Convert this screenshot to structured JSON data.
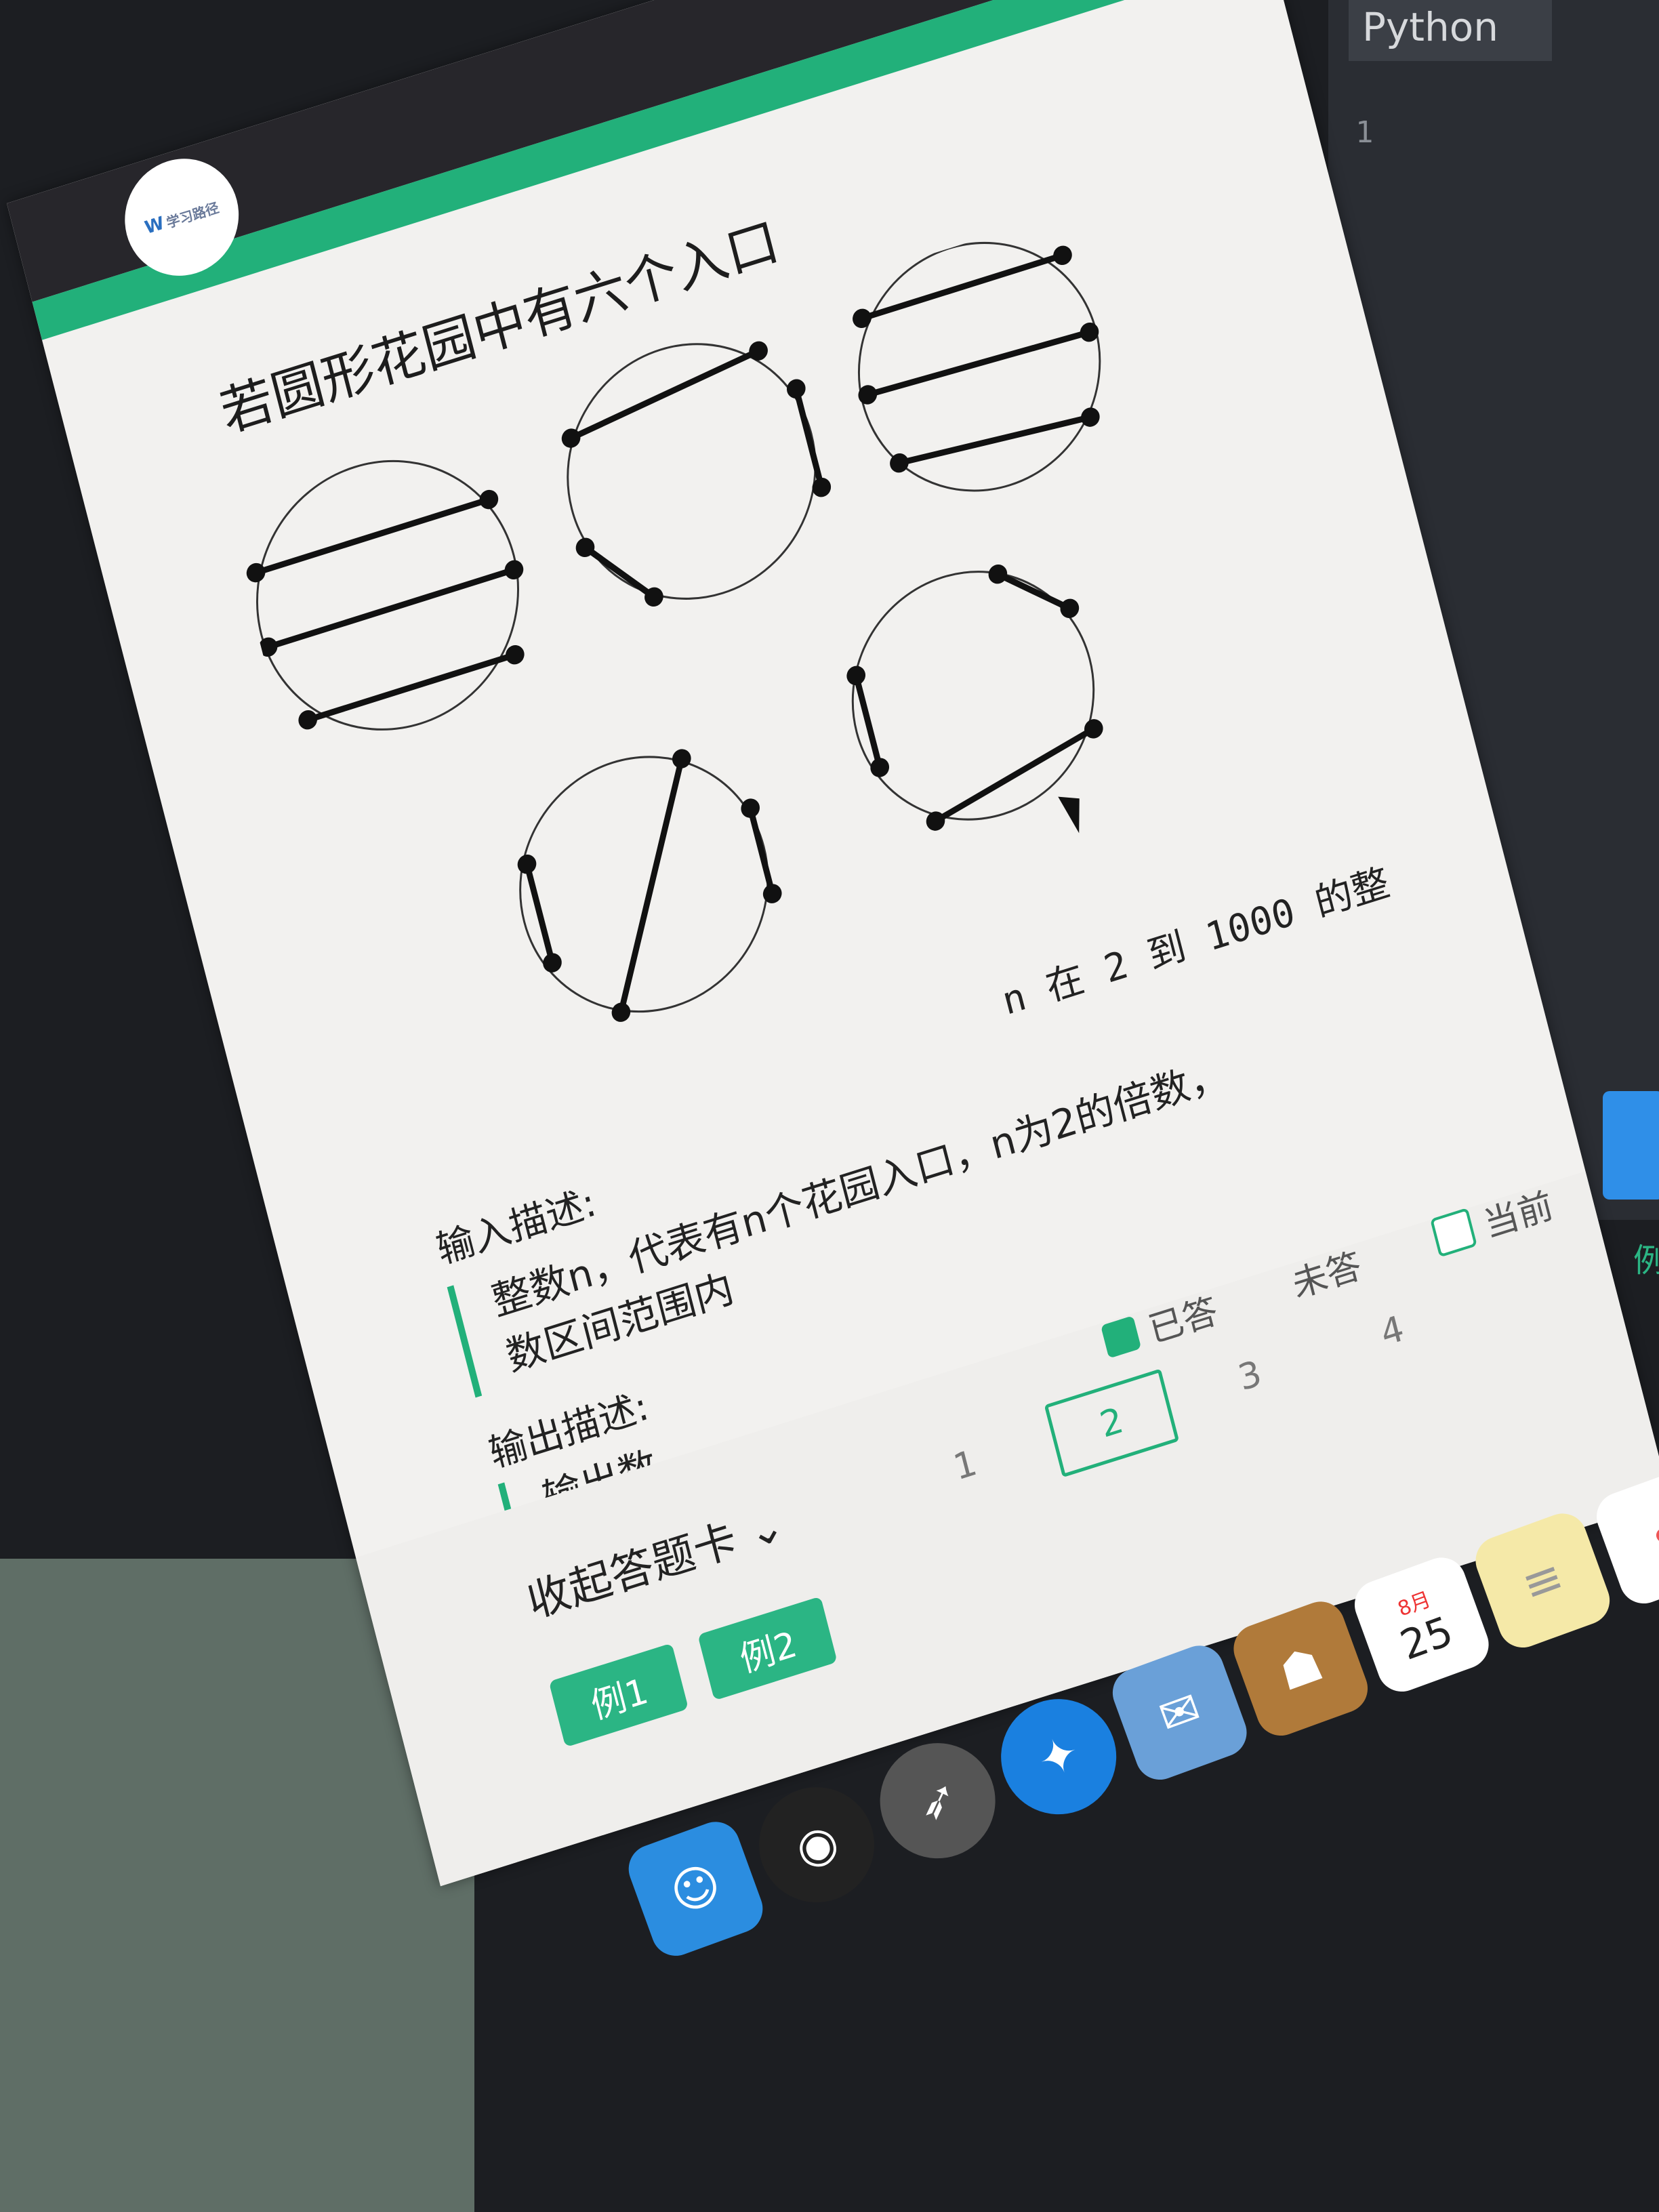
{
  "editor": {
    "tab_label": "Python",
    "line_number": "1",
    "edge_char": "例"
  },
  "header": {
    "logo_text": "学习路径",
    "logo_mark": "W"
  },
  "question": {
    "title": "若圆形花园中有六个入口",
    "extra_line": "n 在 2 到 1000 的整"
  },
  "input_section": {
    "title": "输入描述:",
    "text_line1": "整数n，代表有n个花园入口，n为2的倍数，",
    "text_line2": "数区间范围内"
  },
  "output_section": {
    "title": "输出描述:",
    "text_partial": "输出数"
  },
  "answer_card": {
    "collapse_label": "收起答题卡",
    "chevron": "⌄",
    "legend": [
      {
        "label": "已答",
        "color": "#22b07a"
      },
      {
        "label": "未答",
        "color": "#d8d8d8"
      },
      {
        "label": "当前",
        "color": "#ffffff"
      }
    ],
    "numbers": [
      "1",
      "2",
      "3",
      "4"
    ],
    "current": "2",
    "examples": [
      "例1",
      "例2"
    ]
  },
  "dock": {
    "calendar_month": "8月",
    "calendar_day": "25",
    "items": [
      "finder-icon",
      "siri-icon",
      "launchpad-icon",
      "safari-icon",
      "mail-icon",
      "contacts-icon",
      "calendar-icon",
      "notes-icon",
      "reminders-icon"
    ]
  }
}
